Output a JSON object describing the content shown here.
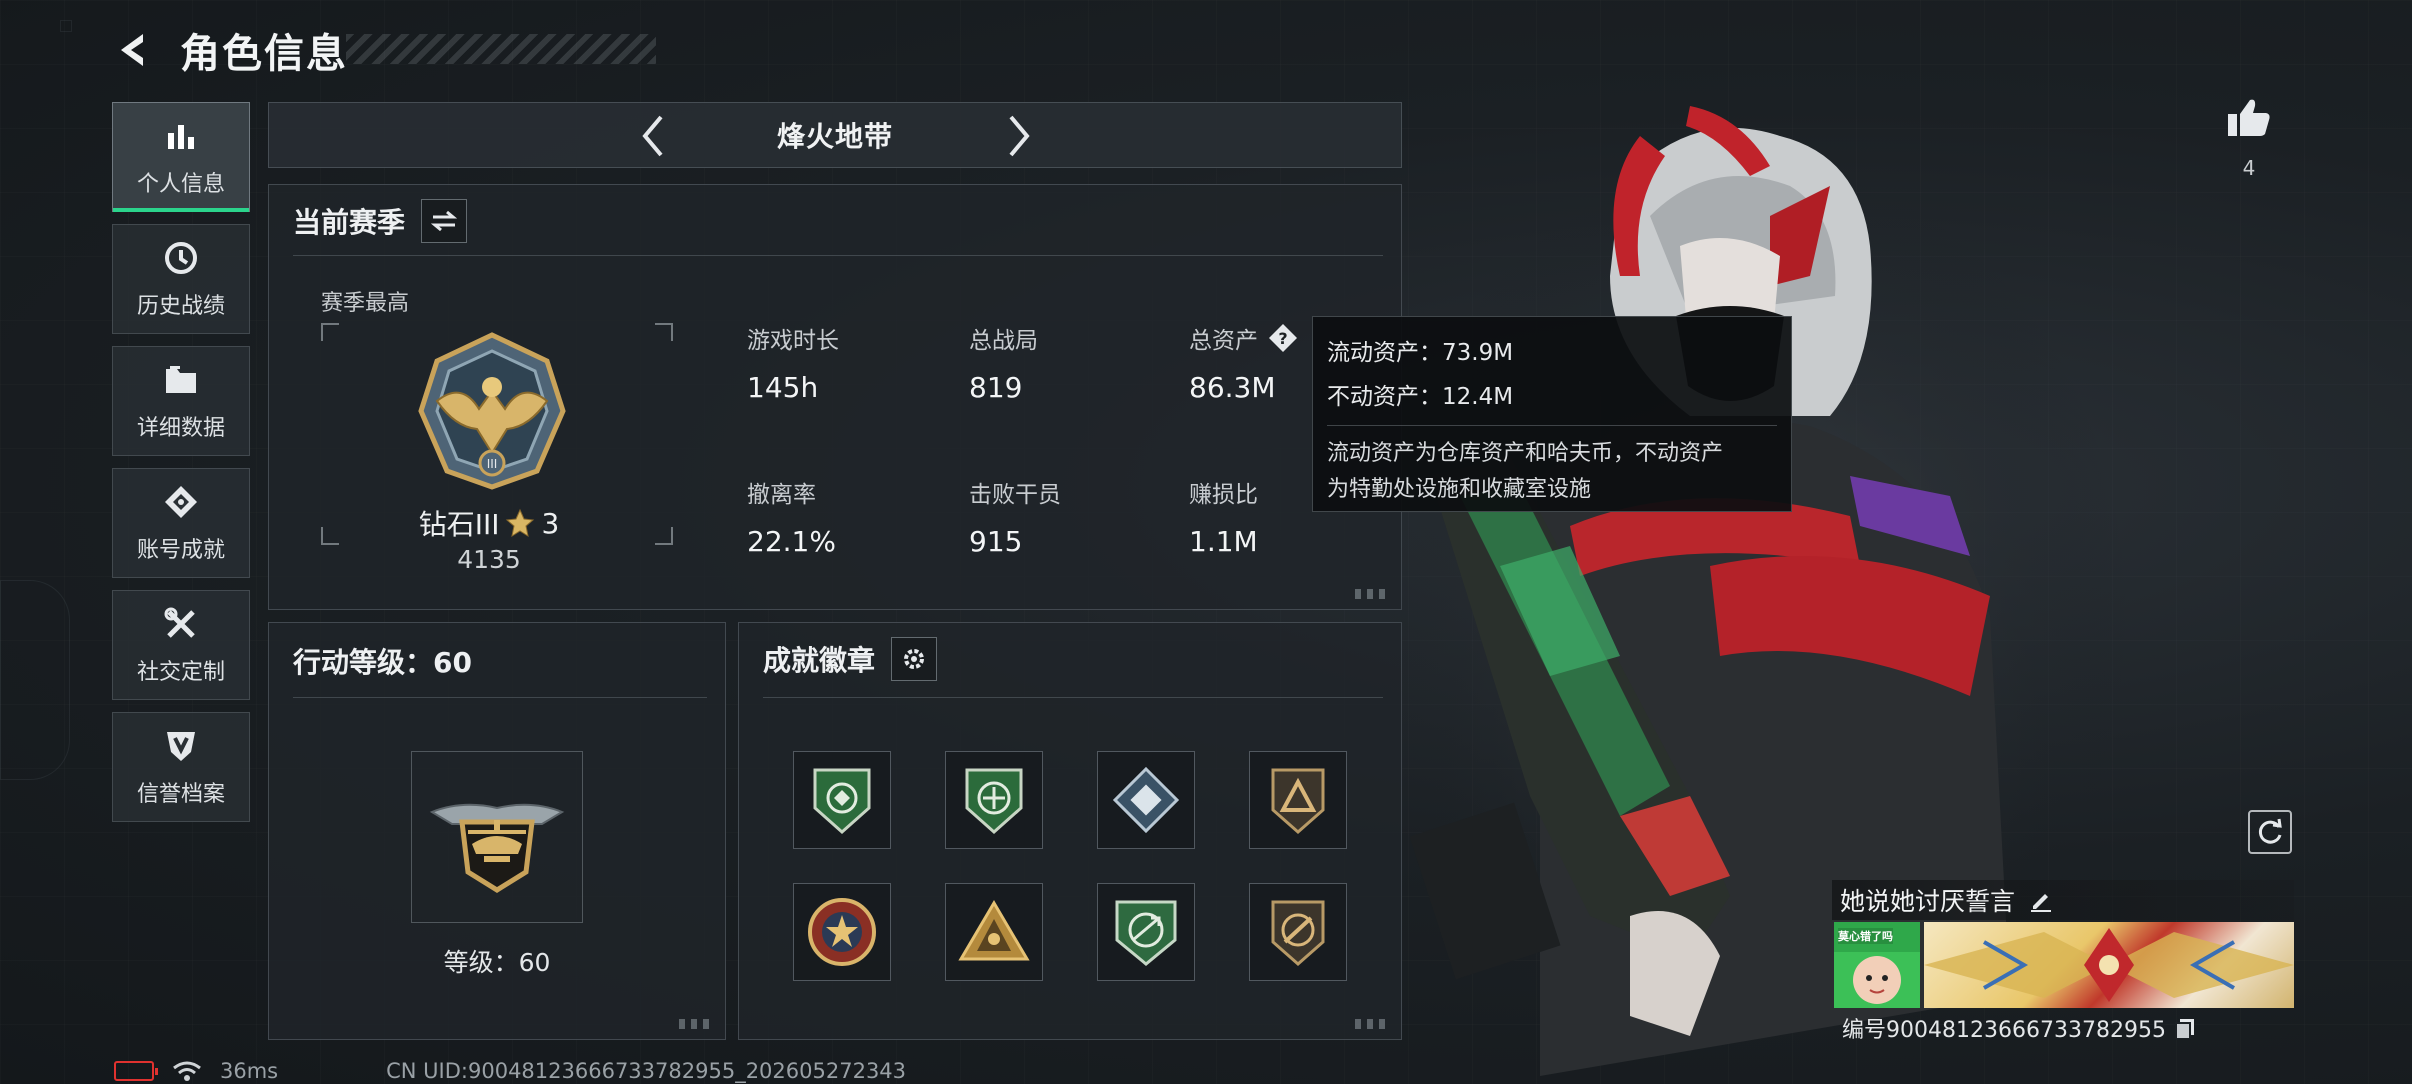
{
  "header": {
    "title": "角色信息"
  },
  "nav": {
    "items": [
      {
        "label": "个人信息",
        "icon": "bar-chart-icon",
        "active": true
      },
      {
        "label": "历史战绩",
        "icon": "history-icon",
        "active": false
      },
      {
        "label": "详细数据",
        "icon": "folder-icon",
        "active": false
      },
      {
        "label": "账号成就",
        "icon": "achievement-icon",
        "active": false
      },
      {
        "label": "社交定制",
        "icon": "tools-icon",
        "active": false
      },
      {
        "label": "信誉档案",
        "icon": "shield-icon",
        "active": false
      }
    ]
  },
  "mode": {
    "title": "烽火地带"
  },
  "season": {
    "title": "当前赛季",
    "best_label": "赛季最高",
    "rank_name": "钻石III",
    "rank_stars": "3",
    "rank_score": "4135",
    "stats": [
      {
        "label": "游戏时长",
        "value": "145h"
      },
      {
        "label": "总战局",
        "value": "819"
      },
      {
        "label": "总资产",
        "value": "86.3M"
      },
      {
        "label": "撤离率",
        "value": "22.1%"
      },
      {
        "label": "击败干员",
        "value": "915"
      },
      {
        "label": "赚损比",
        "value": "1.1M"
      }
    ]
  },
  "tooltip": {
    "liquid": "流动资产：73.9M",
    "fixed": "不动资产：12.4M",
    "note_line1": "流动资产为仓库资产和哈夫币，不动资产",
    "note_line2": "为特勤处设施和收藏室设施"
  },
  "level": {
    "title": "行动等级：60",
    "level_text": "等级：60"
  },
  "achievements": {
    "title": "成就徽章",
    "badges": [
      "badge-green-shield",
      "badge-green-shield-2",
      "badge-blue-diamond",
      "badge-bronze-triangle",
      "badge-red-star-ring",
      "badge-gold-pyramid",
      "badge-green-arrows",
      "badge-gold-rifle"
    ]
  },
  "social": {
    "like_count": "4"
  },
  "player": {
    "name": "她说她讨厌誓言",
    "id": "编号9004812366673378295​5",
    "avatar_text": "莫心错了吗"
  },
  "status": {
    "ping": "36ms",
    "uid": "CN UID:9004812366673378295​5_202605272343"
  },
  "colors": {
    "accent": "#2bd48c",
    "battery": "#e0322f"
  }
}
